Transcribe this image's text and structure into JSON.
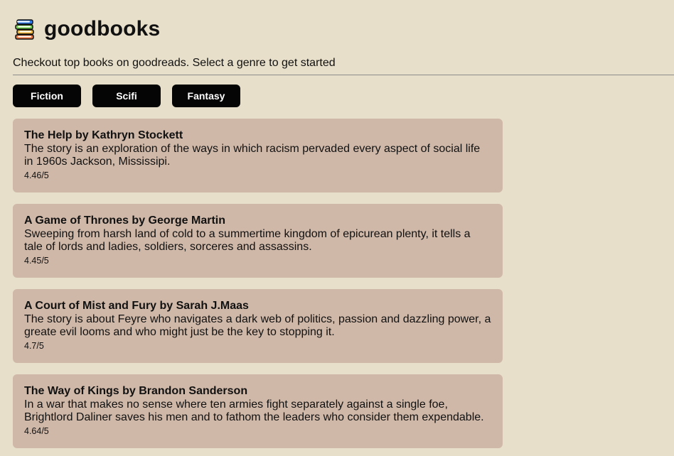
{
  "app": {
    "title": "goodbooks",
    "subtitle": "Checkout top books on goodreads. Select a genre to get started",
    "logo_icon": "books-stack-icon"
  },
  "genres": [
    {
      "label": "Fiction"
    },
    {
      "label": "Scifi"
    },
    {
      "label": "Fantasy"
    }
  ],
  "books": [
    {
      "title": "The Help by Kathryn Stockett",
      "description": "The story is an exploration of the ways in which racism pervaded every aspect of social life in 1960s Jackson, Mississipi.",
      "rating": "4.46/5"
    },
    {
      "title": "A Game of Thrones by George Martin",
      "description": "Sweeping from harsh land of cold to a summertime kingdom of epicurean plenty, it tells a tale of lords and ladies, soldiers, sorceres and assassins.",
      "rating": "4.45/5"
    },
    {
      "title": "A Court of Mist and Fury by Sarah J.Maas",
      "description": "The story is about Feyre who navigates a dark web of politics, passion and dazzling power, a greate evil looms and who might just be the key to stopping it.",
      "rating": "4.7/5"
    },
    {
      "title": "The Way of Kings by Brandon Sanderson",
      "description": "In a war that makes no sense where ten armies fight separately against a single foe, Brightlord Daliner saves his men and to fathom the leaders who consider them expendable.",
      "rating": "4.64/5"
    }
  ],
  "colors": {
    "background": "#e8dfca",
    "card": "#d0b8a8",
    "button": "#050505",
    "button_text": "#ffffff"
  }
}
